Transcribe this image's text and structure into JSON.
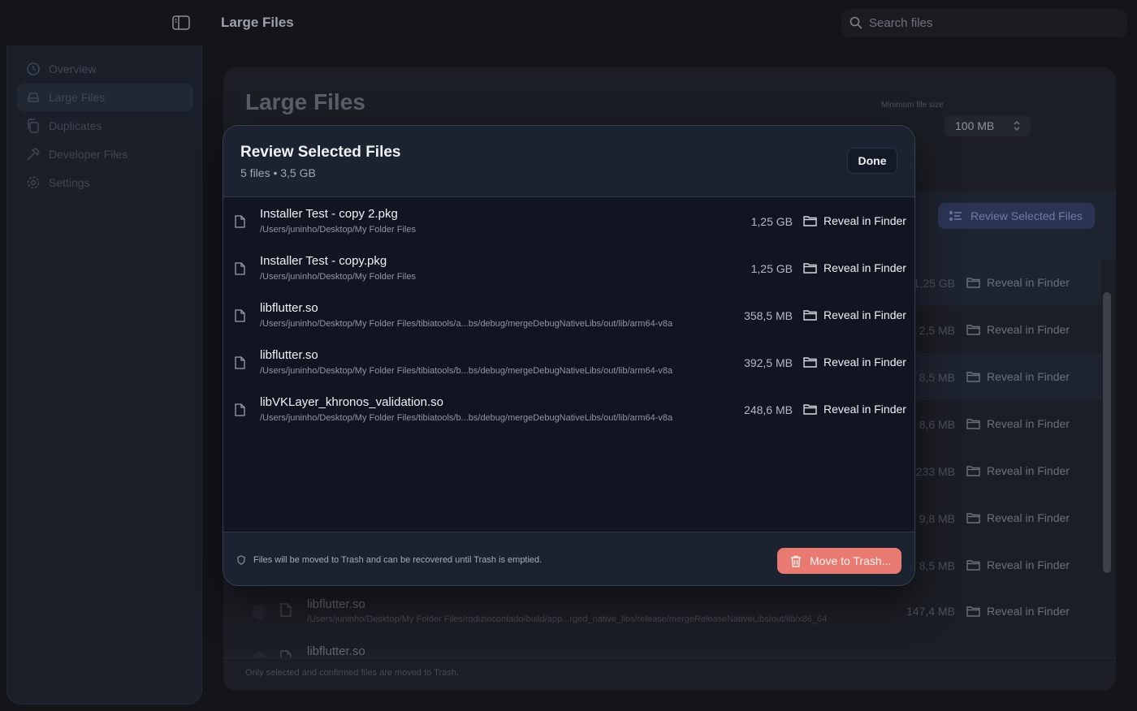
{
  "window": {
    "title": "Large Files"
  },
  "search": {
    "placeholder": "Search files"
  },
  "sidebar": {
    "items": [
      {
        "label": "Overview",
        "icon": "clock-icon"
      },
      {
        "label": "Large Files",
        "icon": "drive-icon",
        "active": true
      },
      {
        "label": "Duplicates",
        "icon": "copy-icon"
      },
      {
        "label": "Developer Files",
        "icon": "hammer-icon"
      },
      {
        "label": "Settings",
        "icon": "gear-icon"
      }
    ]
  },
  "main": {
    "title": "Large Files",
    "min_size_label": "Minimum file size",
    "min_size_value": "100 MB",
    "review_button": "Review Selected Files",
    "reveal_label": "Reveal in Finder",
    "bg_sizes": [
      "1,25 GB",
      "2,5 MB",
      "8,5 MB",
      "8,6 MB",
      "233 MB",
      "9,8 MB",
      "8,5 MB"
    ],
    "bg_files": [
      {
        "name": "libflutter.so",
        "path": "/Users/juninho/Desktop/My Folder Files/rodiziocontado/build/app...rged_native_libs/release/mergeReleaseNativeLibs/out/lib/x86_64",
        "size": "147,4 MB"
      },
      {
        "name": "libflutter.so",
        "path": "",
        "size": ""
      }
    ],
    "footer_note": "Only selected and confirmed files are moved to Trash."
  },
  "modal": {
    "title": "Review Selected Files",
    "subtitle": "5 files • 3,5 GB",
    "done_label": "Done",
    "files": [
      {
        "name": "Installer Test - copy 2.pkg",
        "path": "/Users/juninho/Desktop/My Folder Files",
        "size": "1,25 GB"
      },
      {
        "name": "Installer Test - copy.pkg",
        "path": "/Users/juninho/Desktop/My Folder Files",
        "size": "1,25 GB"
      },
      {
        "name": "libflutter.so",
        "path": "/Users/juninho/Desktop/My Folder Files/tibiatools/a...bs/debug/mergeDebugNativeLibs/out/lib/arm64-v8a",
        "size": "358,5 MB"
      },
      {
        "name": "libflutter.so",
        "path": "/Users/juninho/Desktop/My Folder Files/tibiatools/b...bs/debug/mergeDebugNativeLibs/out/lib/arm64-v8a",
        "size": "392,5 MB"
      },
      {
        "name": "libVKLayer_khronos_validation.so",
        "path": "/Users/juninho/Desktop/My Folder Files/tibiatools/b...bs/debug/mergeDebugNativeLibs/out/lib/arm64-v8a",
        "size": "248,6 MB"
      }
    ],
    "reveal_label": "Reveal in Finder",
    "footer_text": "Files will be moved to Trash and can be recovered until Trash is emptied.",
    "trash_label": "Move to Trash..."
  },
  "colors": {
    "accent": "#e87a72",
    "review_button": "#2b3553"
  }
}
